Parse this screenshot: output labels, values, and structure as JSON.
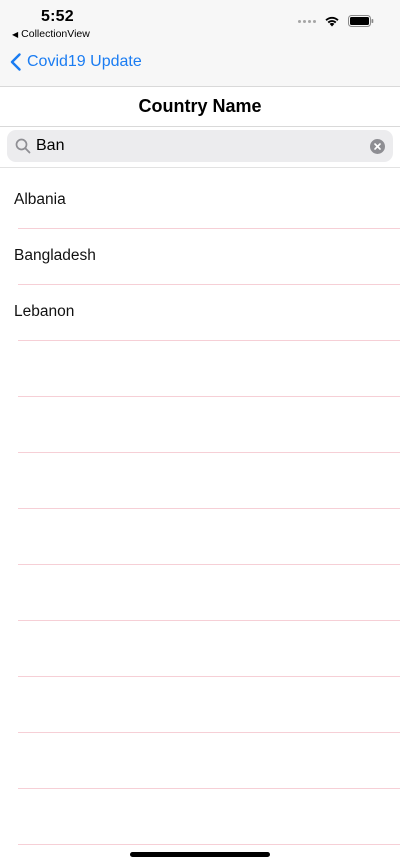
{
  "status_bar": {
    "time": "5:52",
    "back_app": "CollectionView"
  },
  "nav": {
    "back_label": "Covid19 Update",
    "title": "Country Name"
  },
  "search": {
    "value": "Ban",
    "placeholder": ""
  },
  "countries": [
    "Albania",
    "Bangladesh",
    "Lebanon"
  ],
  "empty_rows": 9,
  "colors": {
    "accent": "#1a7cf2",
    "separator": "#f6cfd6",
    "search_bg": "#ececee"
  }
}
